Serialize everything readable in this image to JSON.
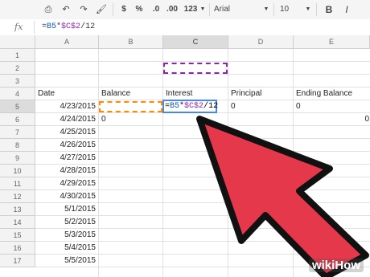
{
  "toolbar": {
    "font": "Arial",
    "size": "10",
    "dollar": "$",
    "percent": "%",
    "dec_down": ".0",
    "dec_up": ".00",
    "more_formats": "123",
    "bold": "B",
    "italic": "I"
  },
  "formula_bar": {
    "fx": "fx",
    "b_ref": "B5",
    "op": "*",
    "c_ref": "$C$2",
    "rest": "/12"
  },
  "columns": [
    "A",
    "B",
    "C",
    "D",
    "E"
  ],
  "rows": [
    "1",
    "2",
    "3",
    "4",
    "5",
    "6",
    "7",
    "8",
    "9",
    "10",
    "11",
    "12",
    "13",
    "14",
    "15",
    "16",
    "17"
  ],
  "headers": {
    "date": "Date",
    "balance": "Balance",
    "interest": "Interest",
    "principal": "Principal",
    "ending_balance": "Ending Balance"
  },
  "row5": {
    "principal": "0",
    "ending_balance": "0"
  },
  "row6": {
    "balance": "0",
    "ending_balance": "0"
  },
  "dates": [
    "4/23/2015",
    "4/24/2015",
    "4/25/2015",
    "4/26/2015",
    "4/27/2015",
    "4/28/2015",
    "4/29/2015",
    "4/30/2015",
    "5/1/2015",
    "5/2/2015",
    "5/3/2015",
    "5/4/2015",
    "5/5/2015"
  ],
  "editing_cell": {
    "eq": "=",
    "b_ref": "B5",
    "op": "*",
    "c_ref": "$C$2",
    "rest": "/12"
  },
  "watermark": {
    "wiki": "wiki",
    "how": "How"
  },
  "colors": {
    "arrow": "#e5384a",
    "arrow_border": "#111111",
    "b_ref": "#1155cc",
    "c_ref": "#8e24aa",
    "active_border": "#4a86e8"
  }
}
